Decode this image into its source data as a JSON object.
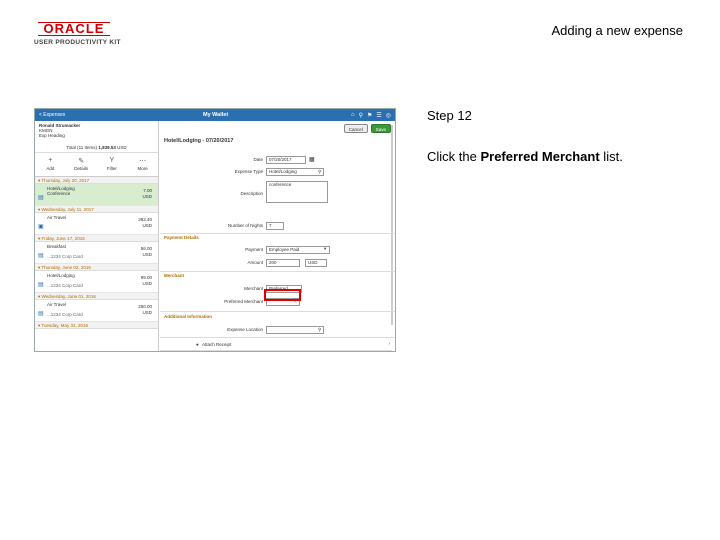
{
  "slide": {
    "logo_text": "ORACLE",
    "logo_sub": "USER PRODUCTIVITY KIT",
    "title": "Adding a new expense",
    "step": "Step 12",
    "instruction_pre": "Click the ",
    "instruction_bold": "Preferred Merchant",
    "instruction_post": " list."
  },
  "app": {
    "back_label": "< Expenses",
    "title": "My Wallet",
    "user_name": "Ronald Strumacker",
    "user_id": "KMGN",
    "user_sub": "Exp Heading",
    "total_label": "Total (11 Items)",
    "total_value": "1,839.53",
    "total_currency": "USD",
    "actions": [
      {
        "icon": "+",
        "label": "Add"
      },
      {
        "icon": "✎",
        "label": "Details"
      },
      {
        "icon": "Y",
        "label": "Filter"
      },
      {
        "icon": "⋯",
        "label": "More"
      }
    ],
    "groups": [
      {
        "date": "▾ Thursday, July 20, 2017",
        "items": [
          {
            "title": "Hotel/Lodging",
            "sub": "Conference",
            "amount": "7.00",
            "cur": "USD",
            "sel": true
          }
        ]
      },
      {
        "date": "▾ Wednesday, July 11, 2017",
        "items": [
          {
            "title": "Air Travel",
            "sub": "",
            "amount": "392.40",
            "cur": "USD",
            "sel": false
          }
        ]
      },
      {
        "date": "▾ Friday, June 17, 2016",
        "items": [
          {
            "title": "Breakfast",
            "sub": "...1234 Corp Card",
            "amount": "56.00",
            "cur": "USD",
            "sel": false
          }
        ]
      },
      {
        "date": "▾ Thursday, June 02, 2016",
        "items": [
          {
            "title": "Hotel/Lodging",
            "sub": "...1234 Corp Card",
            "amount": "99.00",
            "cur": "USD",
            "sel": false
          }
        ]
      },
      {
        "date": "▾ Wednesday, June 01, 2016",
        "items": [
          {
            "title": "Air Travel",
            "sub": "...1234 Corp Card",
            "amount": "250.00",
            "cur": "USD",
            "sel": false
          }
        ]
      }
    ],
    "last_group": "▾ Tuesday, May 31, 2016",
    "cancel_label": "Cancel",
    "save_label": "Save",
    "detail_title": "Hotel/Lodging - 07/20/2017",
    "fields": {
      "date_label": "Date",
      "date_value": "07/20/2017",
      "type_label": "Expense Type",
      "type_value": "Hotel/Lodging",
      "desc_label": "Description",
      "desc_value": "conference",
      "nights_label": "Number of Nights",
      "nights_value": "7",
      "payment_section": "Payment Details",
      "paytype_label": "Payment",
      "paytype_value": "Employee Paid",
      "amount_label": "Amount",
      "amount_value": "200",
      "currency_value": "USD",
      "merchant_section": "Merchant",
      "merchant_label": "Merchant",
      "merchant_value": "Preferred",
      "pref_label": "Preferred Merchant",
      "pref_value": "",
      "addl_section": "Additional Information",
      "loc_label": "Expense Location",
      "loc_value": "",
      "attach_label": "Attach Receipt"
    }
  }
}
